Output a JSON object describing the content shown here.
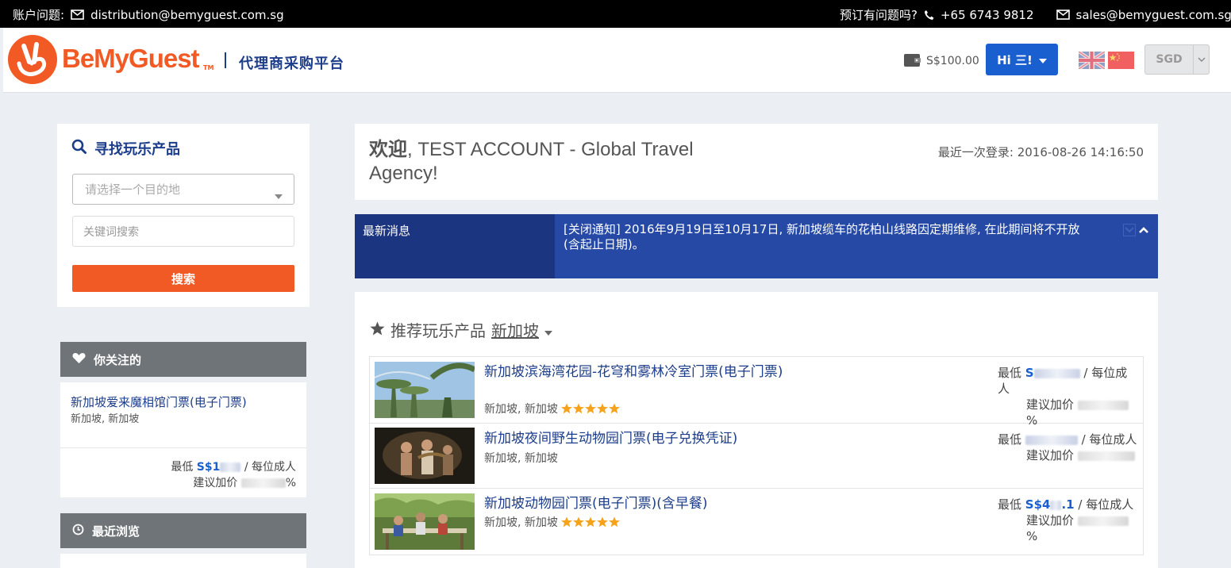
{
  "topbar": {
    "account_label": "账户问题:",
    "account_email": "distribution@bemyguest.com.sg",
    "booking_label": "预订有问题吗?",
    "phone": "+65 6743 9812",
    "sales_email": "sales@bemyguest.com.sg"
  },
  "header": {
    "logo_text": "BeMyGuest",
    "logo_tm": "TM",
    "platform": "代理商采购平台",
    "wallet_balance": "S$100.00",
    "user_button": "Hi 三!",
    "currency": "SGD"
  },
  "search": {
    "title": "寻找玩乐产品",
    "destination_placeholder": "请选择一个目的地",
    "keyword_placeholder": "关键词搜索",
    "button": "搜索"
  },
  "favourites": {
    "title": "你关注的",
    "item": {
      "name": "新加坡爱来魔相馆门票(电子门票)",
      "location": "新加坡, 新加坡",
      "price_label": "最低",
      "price_prefix": "S$1",
      "price_suffix": "/ 每位成人",
      "markup_label": "建议加价",
      "markup_suffix": "%"
    }
  },
  "recent": {
    "title": "最近浏览"
  },
  "welcome": {
    "greeting": "欢迎",
    "account": ", TEST ACCOUNT - Global Travel Agency!",
    "last_login_label": "最近一次登录:",
    "last_login": "2016-08-26 14:16:50"
  },
  "news": {
    "label": "最新消息",
    "text": "[关闭通知] 2016年9月19日至10月17日, 新加坡缆车的花柏山线路因定期维修, 在此期间将不开放(含起止日期)。"
  },
  "recommended": {
    "title": "推荐玩乐产品",
    "city": "新加坡",
    "products": [
      {
        "name": "新加坡滨海湾花园-花穹和雾林冷室门票(电子门票)",
        "location": "新加坡, 新加坡",
        "rating": 5,
        "price_label": "最低",
        "price_prefix": "S",
        "per": "/ 每位成人",
        "markup_label": "建议加价",
        "markup_suffix": "%"
      },
      {
        "name": "新加坡夜间野生动物园门票(电子兑换凭证)",
        "location": "新加坡, 新加坡",
        "rating": 0,
        "price_label": "最低",
        "price_prefix": "",
        "per": "/ 每位成人",
        "markup_label": "建议加价",
        "markup_suffix": ""
      },
      {
        "name": "新加坡动物园门票(电子门票)(含早餐)",
        "location": "新加坡, 新加坡",
        "rating": 5,
        "price_label": "最低",
        "price_prefix": "S$4",
        "price_tail": ".1",
        "per": "/ 每位成人",
        "markup_label": "建议加价",
        "markup_suffix": "%"
      }
    ]
  },
  "colors": {
    "brand_orange": "#f15a24",
    "brand_navy": "#1c3d8a",
    "primary_blue": "#1a5fd0",
    "news_bg": "#2549a5",
    "star": "#f7a21b"
  }
}
